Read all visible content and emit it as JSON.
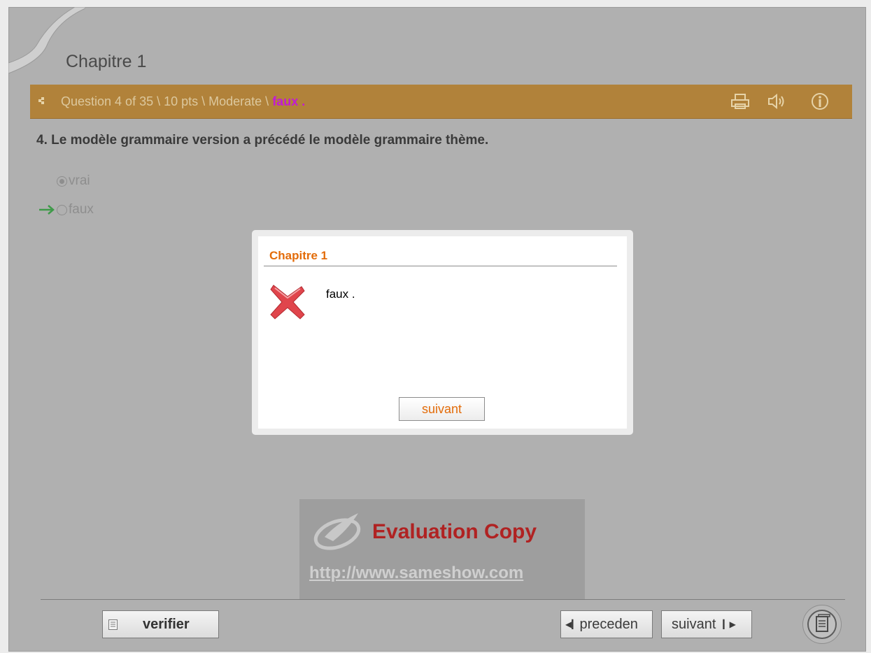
{
  "chapter": {
    "title": "Chapitre 1"
  },
  "question_bar": {
    "info": "Question 4 of 35 \\ 10 pts \\ Moderate \\ ",
    "status": "faux .",
    "status_color": "#c21bd4",
    "bar_color": "#b1823a",
    "icons": [
      "print-icon",
      "sound-icon",
      "info-icon"
    ]
  },
  "question": {
    "text": "4. Le modèle grammaire version a précédé le modèle grammaire thème.",
    "options": [
      {
        "label": "vrai",
        "selected": true
      },
      {
        "label": "faux",
        "selected": false,
        "correct": true
      }
    ]
  },
  "dialog": {
    "title": "Chapitre 1",
    "message": "faux .",
    "button_label": "suivant",
    "accent_color": "#e36c0a"
  },
  "watermark": {
    "title": "Evaluation Copy",
    "url": "http://www.sameshow.com"
  },
  "footer": {
    "verify_label": "verifier",
    "prev_label": "preceden",
    "next_label": "suivant"
  }
}
